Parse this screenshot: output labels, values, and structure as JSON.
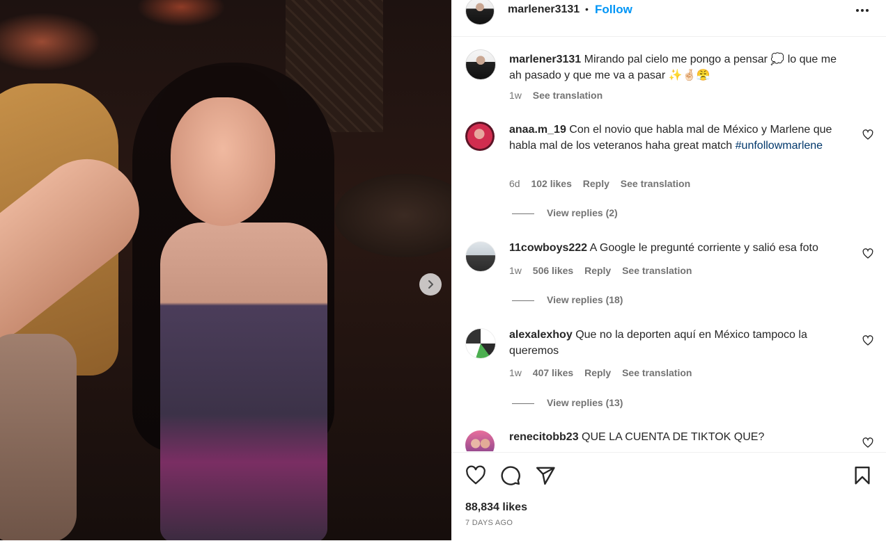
{
  "post": {
    "owner": "marlener3131",
    "separator": "•",
    "follow_label": "Follow",
    "more_icon": "more-options-icon"
  },
  "caption": {
    "username": "marlener3131",
    "text_part1": "Mirando pal cielo me pongo a pensar 💭 lo que me ah pasado y que me va a pasar ✨🤞🏻😤",
    "time": "1w",
    "translate": "See translation"
  },
  "comments": [
    {
      "username": "anaa.m_19",
      "text": "Con el novio que habla mal de México y Marlene que habla mal de los veteranos haha great match",
      "hashtag": "#unfollowmarlene",
      "time": "6d",
      "likes": "102 likes",
      "reply": "Reply",
      "translate": "See translation",
      "view_replies": "View replies (2)"
    },
    {
      "username": "11cowboys222",
      "text": "A Google le pregunté corriente y salió esa foto",
      "time": "1w",
      "likes": "506 likes",
      "reply": "Reply",
      "translate": "See translation",
      "view_replies": "View replies (18)"
    },
    {
      "username": "alexalexhoy",
      "text": "Que no la deporten aquí en México tampoco la queremos",
      "time": "1w",
      "likes": "407 likes",
      "reply": "Reply",
      "translate": "See translation",
      "view_replies": "View replies (13)"
    },
    {
      "username": "renecitobb23",
      "text": "QUE LA CUENTA DE TIKTOK QUE?"
    }
  ],
  "footer": {
    "likes": "88,834 likes",
    "date": "7 DAYS AGO"
  },
  "colors": {
    "link": "#0095f6",
    "hashtag": "#00376b",
    "muted": "#737373",
    "text": "#262626"
  }
}
